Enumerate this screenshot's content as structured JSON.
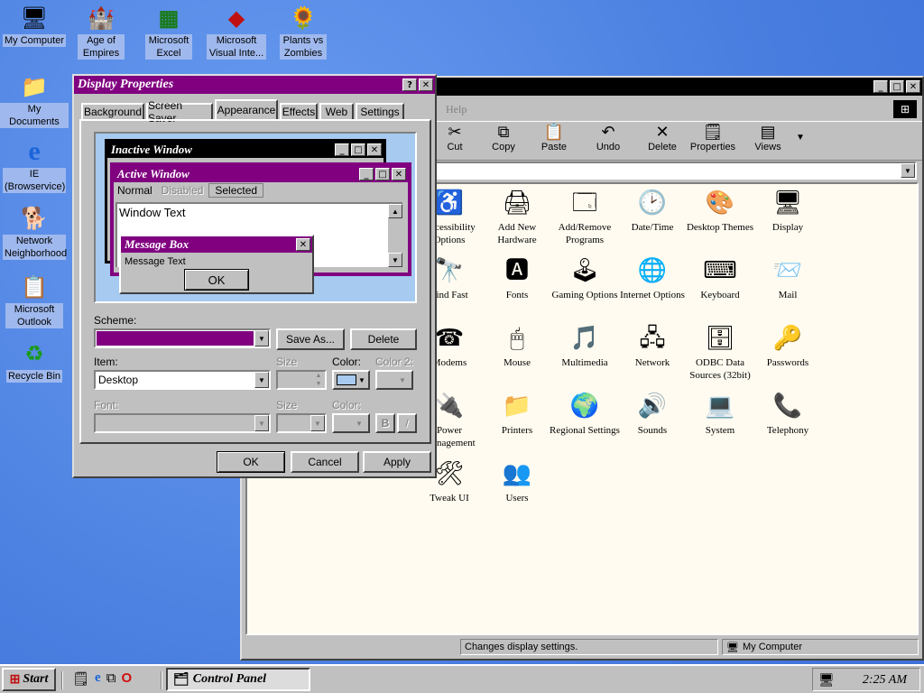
{
  "desktop": {
    "icons": [
      {
        "label": "My Computer",
        "icon": "computer-icon"
      },
      {
        "label": "My Documents",
        "icon": "folder-icon"
      },
      {
        "label": "IE (Browservice)",
        "icon": "ie-icon"
      },
      {
        "label": "Network Neighborhood",
        "icon": "network-icon"
      },
      {
        "label": "Microsoft Outlook",
        "icon": "outlook-icon"
      },
      {
        "label": "Recycle Bin",
        "icon": "recycle-bin-icon"
      },
      {
        "label": "Age of Empires",
        "icon": "age-of-empires-icon"
      },
      {
        "label": "Microsoft Excel",
        "icon": "excel-icon"
      },
      {
        "label": "Microsoft Visual Inte...",
        "icon": "visual-interdev-icon"
      },
      {
        "label": "Plants vs Zombies",
        "icon": "plants-vs-zombies-icon"
      }
    ]
  },
  "control_panel": {
    "menu_help": "Help",
    "toolbar": [
      {
        "label": "Cut",
        "icon": "cut-icon"
      },
      {
        "label": "Copy",
        "icon": "copy-icon"
      },
      {
        "label": "Paste",
        "icon": "paste-icon"
      },
      {
        "label": "Undo",
        "icon": "undo-icon"
      },
      {
        "label": "Delete",
        "icon": "delete-icon"
      },
      {
        "label": "Properties",
        "icon": "properties-icon"
      },
      {
        "label": "Views",
        "icon": "views-icon"
      }
    ],
    "items": [
      {
        "label": "Accessibility Options",
        "icon": "accessibility-icon"
      },
      {
        "label": "Add New Hardware",
        "icon": "add-hardware-icon"
      },
      {
        "label": "Add/Remove Programs",
        "icon": "add-remove-programs-icon"
      },
      {
        "label": "Date/Time",
        "icon": "date-time-icon"
      },
      {
        "label": "Desktop Themes",
        "icon": "desktop-themes-icon"
      },
      {
        "label": "Display",
        "icon": "display-icon"
      },
      {
        "label": "Find Fast",
        "icon": "find-fast-icon"
      },
      {
        "label": "Fonts",
        "icon": "fonts-icon"
      },
      {
        "label": "Gaming Options",
        "icon": "gaming-icon"
      },
      {
        "label": "Internet Options",
        "icon": "internet-options-icon"
      },
      {
        "label": "Keyboard",
        "icon": "keyboard-icon"
      },
      {
        "label": "Mail",
        "icon": "mail-icon"
      },
      {
        "label": "Modems",
        "icon": "modem-icon"
      },
      {
        "label": "Mouse",
        "icon": "mouse-icon"
      },
      {
        "label": "Multimedia",
        "icon": "multimedia-icon"
      },
      {
        "label": "Network",
        "icon": "network-icon"
      },
      {
        "label": "ODBC Data Sources (32bit)",
        "icon": "odbc-icon"
      },
      {
        "label": "Passwords",
        "icon": "passwords-icon"
      },
      {
        "label": "Power Management",
        "icon": "power-icon"
      },
      {
        "label": "Printers",
        "icon": "printers-icon"
      },
      {
        "label": "Regional Settings",
        "icon": "globe-icon"
      },
      {
        "label": "Sounds",
        "icon": "sounds-icon"
      },
      {
        "label": "System",
        "icon": "system-icon"
      },
      {
        "label": "Telephony",
        "icon": "telephony-icon"
      },
      {
        "label": "Tweak UI",
        "icon": "tweak-ui-icon"
      },
      {
        "label": "Users",
        "icon": "users-icon"
      }
    ],
    "status_left": "Changes display settings.",
    "status_right": "My Computer"
  },
  "display_properties": {
    "title": "Display Properties",
    "tabs": [
      "Background",
      "Screen Saver",
      "Appearance",
      "Effects",
      "Web",
      "Settings"
    ],
    "active_tab": "Appearance",
    "preview": {
      "inactive_title": "Inactive Window",
      "active_title": "Active Window",
      "menu_normal": "Normal",
      "menu_disabled": "Disabled",
      "menu_selected": "Selected",
      "window_text": "Window Text",
      "msgbox_title": "Message Box",
      "msgbox_text": "Message Text",
      "msgbox_ok": "OK"
    },
    "scheme_label": "Scheme:",
    "scheme_value": "",
    "save_as": "Save As...",
    "delete": "Delete",
    "item_label": "Item:",
    "item_value": "Desktop",
    "size_label": "Size",
    "color_label": "Color:",
    "color2_label": "Color 2:",
    "font_label": "Font:",
    "font_size_label": "Size",
    "font_color_label": "Color:",
    "bold": "B",
    "italic": "/",
    "ok": "OK",
    "cancel": "Cancel",
    "apply": "Apply"
  },
  "taskbar": {
    "start": "Start",
    "task": "Control Panel",
    "clock": "2:25 AM"
  },
  "colors": {
    "title_active": "#800080",
    "desktop": "#4a7fe0",
    "item_color_swatch": "#a6caf0"
  }
}
